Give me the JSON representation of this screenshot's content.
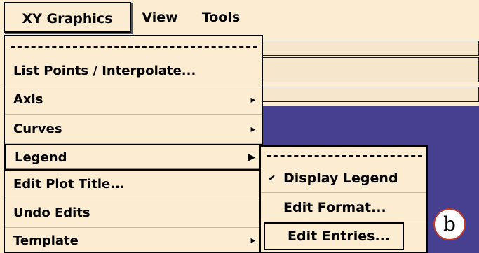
{
  "menubar": {
    "items": [
      "XY Graphics",
      "View",
      "Tools"
    ]
  },
  "xy_menu": {
    "items": [
      {
        "label": "List Points / Interpolate...",
        "arrow": ""
      },
      {
        "label": "Axis",
        "arrow": "▸"
      },
      {
        "label": "Curves",
        "arrow": "▸"
      },
      {
        "label": "Legend",
        "arrow": "▶"
      },
      {
        "label": "Edit Plot Title...",
        "arrow": ""
      },
      {
        "label": "Undo Edits",
        "arrow": ""
      },
      {
        "label": "Template",
        "arrow": "▸"
      }
    ]
  },
  "legend_submenu": {
    "items": [
      {
        "label": "Display Legend",
        "check": "✔"
      },
      {
        "label": "Edit Format...",
        "check": ""
      },
      {
        "label": "Edit Entries...",
        "check": ""
      }
    ]
  },
  "callout": {
    "label": "b"
  },
  "colors": {
    "menu_bg": "#fbecd2",
    "canvas_bg": "#473f8f",
    "callout_border": "#c0392b"
  }
}
